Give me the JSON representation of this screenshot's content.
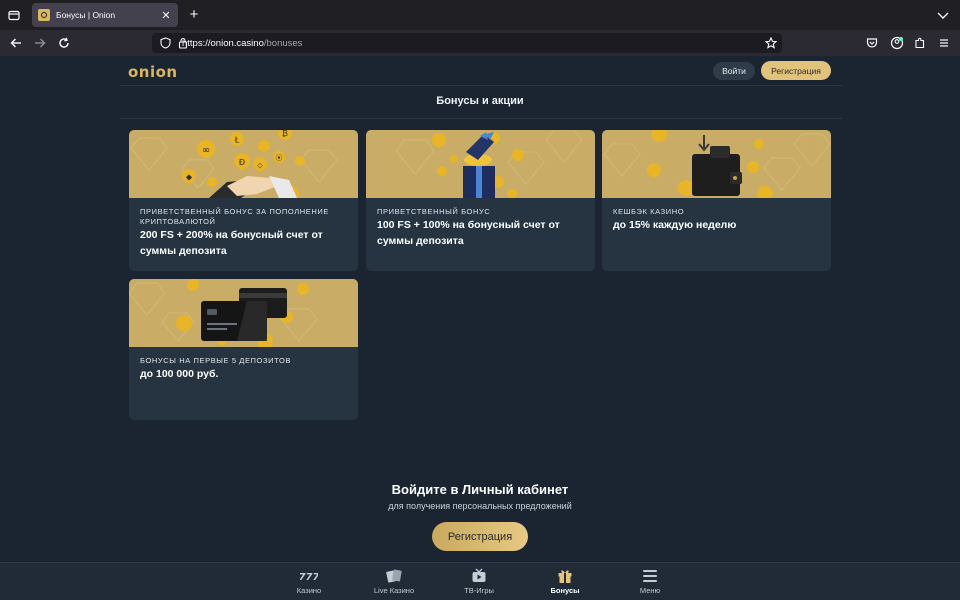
{
  "browser": {
    "tab_title": "Бонусы | Onion",
    "url_host": "https://onion.casino",
    "url_path": "/bonuses"
  },
  "header": {
    "logo_text": "onion",
    "login_label": "Войти",
    "register_label": "Регистрация"
  },
  "page": {
    "title": "Бонусы и акции"
  },
  "bonuses": [
    {
      "category": "Приветственный бонус за пополнение криптовалютой",
      "value": "200 FS + 200% на бонусный счет от суммы депозита",
      "image": "crypto-coins-handshake"
    },
    {
      "category": "Приветственный бонус",
      "value": "100 FS + 100% на бонусный счет от суммы депозита",
      "image": "gift-box-coins"
    },
    {
      "category": "Кешбэк казино",
      "value": "до 15% каждую неделю",
      "image": "wallet-coins"
    },
    {
      "category": "Бонусы на первые 5 депозитов",
      "value": "до 100 000 руб.",
      "image": "bank-cards-coins"
    }
  ],
  "cta": {
    "title": "Войдите в Личный кабинет",
    "subtitle": "для получения персональных предложений",
    "button_label": "Регистрация"
  },
  "bottom_nav": [
    {
      "label": "Казино",
      "icon": "casino-777-icon"
    },
    {
      "label": "Live Казино",
      "icon": "cards-icon"
    },
    {
      "label": "ТВ-Игры",
      "icon": "tv-play-icon"
    },
    {
      "label": "Бонусы",
      "icon": "gift-icon",
      "active": true
    },
    {
      "label": "Меню",
      "icon": "menu-icon"
    }
  ],
  "colors": {
    "background": "#1b2531",
    "card": "#263340",
    "gold": "#e2c37c",
    "card_image_bg": "#c9ad67"
  }
}
